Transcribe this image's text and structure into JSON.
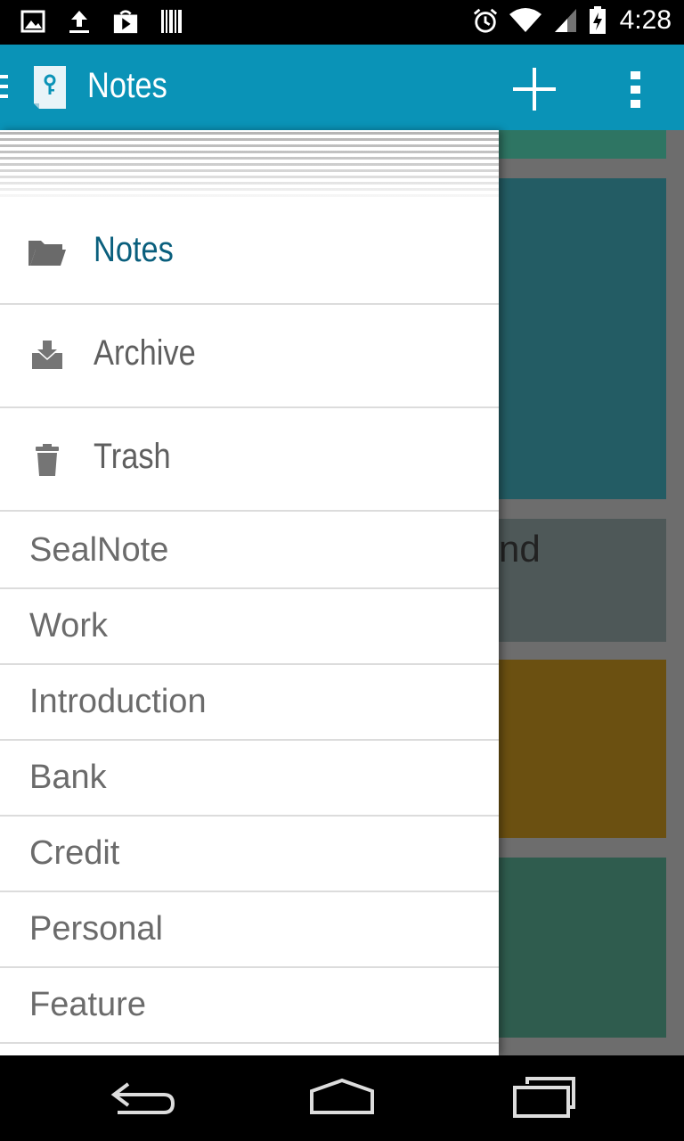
{
  "status_bar": {
    "time": "4:28",
    "left_icons": [
      "image-icon",
      "upload-icon",
      "play-store-icon",
      "barcode-icon"
    ],
    "right_icons": [
      "alarm-icon",
      "wifi-icon",
      "signal-icon",
      "battery-charging-icon"
    ]
  },
  "app_bar": {
    "title": "Notes",
    "background": "#0a93b7",
    "actions": [
      "add-icon",
      "overflow-menu-icon"
    ]
  },
  "drawer": {
    "nav_items": [
      {
        "label": "Notes",
        "icon": "folder-icon",
        "active": true
      },
      {
        "label": "Archive",
        "icon": "archive-icon",
        "active": false
      },
      {
        "label": "Trash",
        "icon": "trash-icon",
        "active": false
      }
    ],
    "labels": [
      "SealNote",
      "Work",
      "Introduction",
      "Bank",
      "Credit",
      "Personal",
      "Feature"
    ]
  },
  "background_notes": [
    {
      "color": "#2e7563"
    },
    {
      "color": "#235c64"
    },
    {
      "color": "#4e5858",
      "text_fragment": "nd"
    },
    {
      "color": "#6b5011"
    },
    {
      "color": "#2f5c4e"
    }
  ],
  "colors": {
    "accent": "#0a93b7",
    "active_label": "#0a5f7d"
  }
}
